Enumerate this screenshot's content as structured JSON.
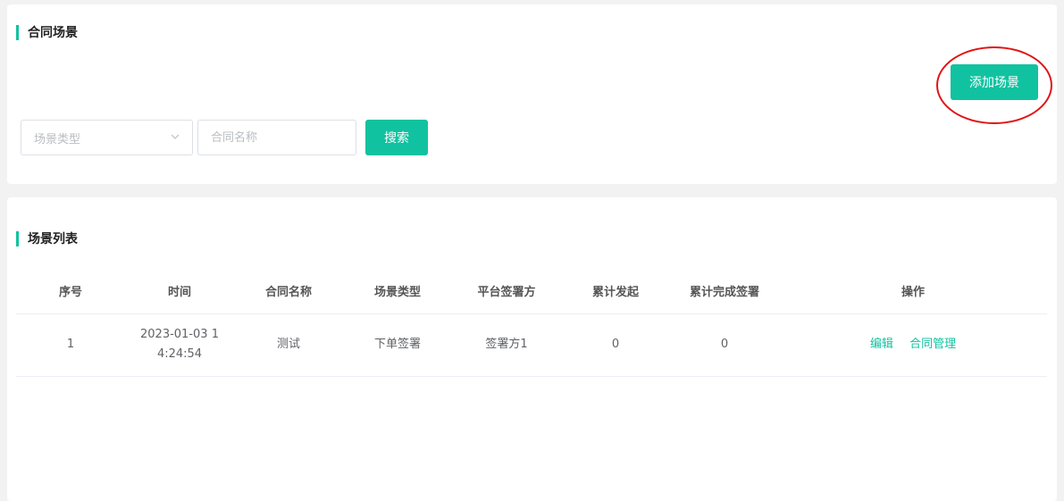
{
  "top_section": {
    "title": "合同场景",
    "add_button": "添加场景",
    "scene_type_placeholder": "场景类型",
    "contract_name_placeholder": "合同名称",
    "search_button": "搜索"
  },
  "list_section": {
    "title": "场景列表",
    "headers": [
      "序号",
      "时间",
      "合同名称",
      "场景类型",
      "平台签署方",
      "累计发起",
      "累计完成签署",
      "操作"
    ],
    "rows": [
      {
        "index": "1",
        "time": "2023-01-03 14:24:54",
        "contract_name": "测试",
        "scene_type": "下单签署",
        "platform_signer": "签署方1",
        "total_initiated": "0",
        "total_completed": "0",
        "actions": [
          "编辑",
          "合同管理"
        ]
      }
    ]
  },
  "colors": {
    "accent": "#11c2a0",
    "highlight_ring": "#e01515"
  }
}
